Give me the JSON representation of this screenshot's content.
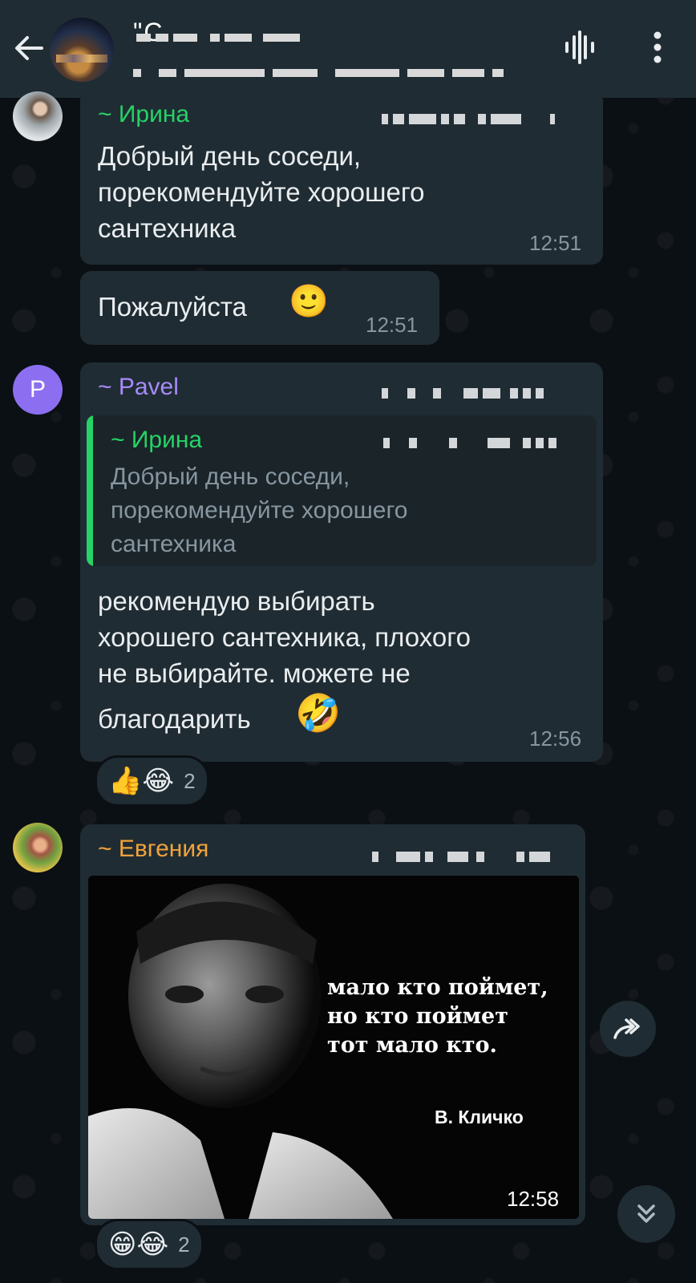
{
  "header": {
    "title": "\"С",
    "back_icon": "arrow-left-icon",
    "voice_icon": "voice-wave-icon",
    "menu_icon": "more-vertical-icon"
  },
  "messages": [
    {
      "sender": "~ Ирина",
      "text": "Добрый день соседи,\nпорекомендуйте хорошего\nсантехника",
      "time": "12:51"
    },
    {
      "text": "Пожалуйста",
      "emoji": "🙂",
      "time": "12:51"
    },
    {
      "avatar_letter": "P",
      "sender": "~ Pavel",
      "reply": {
        "sender": "~ Ирина",
        "text": "Добрый день соседи,\nпорекомендуйте хорошего\nсантехника"
      },
      "text_lines": [
        "рекомендую выбирать",
        "хорошего сантехника, плохого",
        "не выбирайте. можете не",
        "благодарить"
      ],
      "emoji": "🤣",
      "time": "12:56",
      "reactions": {
        "emojis": "👍😂",
        "count": "2"
      }
    },
    {
      "sender": "~ Евгения",
      "image_text": {
        "line1": "мало кто поймет,",
        "line2": "но кто поймет",
        "line3": "тот мало кто.",
        "author": "В. Кличко"
      },
      "time": "12:58",
      "reactions": {
        "emojis": "😁😂",
        "count": "2"
      }
    }
  ],
  "colors": {
    "background": "#0b1014",
    "bubble": "#202c33",
    "header": "#1f2c33",
    "irina": "#25d366",
    "pavel": "#a78bfa",
    "evgenia": "#f2a33a",
    "time": "#8696a0"
  }
}
